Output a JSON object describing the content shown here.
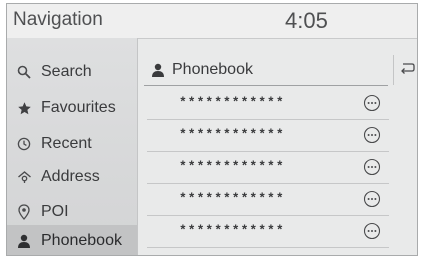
{
  "header": {
    "title": "Navigation",
    "time": "4:05"
  },
  "sidebar": {
    "items": [
      {
        "label": "Search",
        "icon": "search-icon",
        "active": false
      },
      {
        "label": "Favourites",
        "icon": "star-icon",
        "active": false
      },
      {
        "label": "Recent",
        "icon": "clock-icon",
        "active": false
      },
      {
        "label": "Address",
        "icon": "address-icon",
        "active": false
      },
      {
        "label": "POI",
        "icon": "location-pin-icon",
        "active": false
      },
      {
        "label": "Phonebook",
        "icon": "person-icon",
        "active": true
      }
    ]
  },
  "panel": {
    "title": "Phonebook",
    "title_icon": "person-icon",
    "back_icon": "back-arrow-icon",
    "contacts": [
      {
        "name": "************"
      },
      {
        "name": "************"
      },
      {
        "name": "************"
      },
      {
        "name": "************"
      },
      {
        "name": "************"
      }
    ],
    "row_action_icon": "more-options-icon"
  }
}
